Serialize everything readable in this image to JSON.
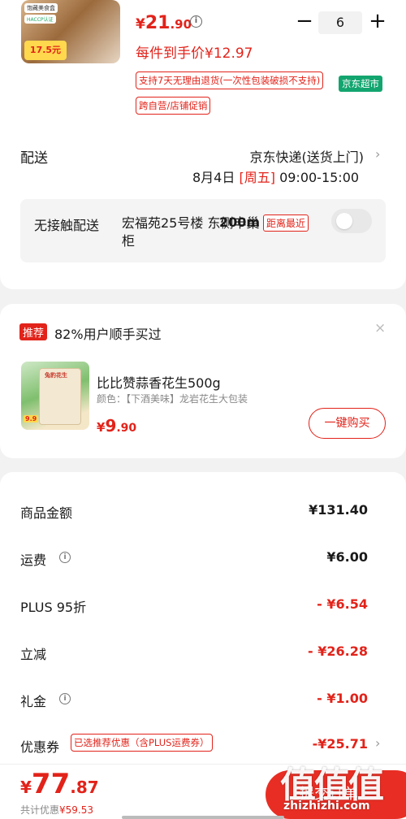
{
  "product": {
    "thumb_tags": [
      "饱藏美食盒",
      "HACCP认证",
      "17.5元"
    ],
    "price_currency": "¥",
    "price_int": "21",
    "price_dec": ".90",
    "quantity": "6",
    "minus_label": "−",
    "plus_label": "+",
    "hand_price": "每件到手价¥12.97",
    "return_policy": "支持7天无理由退货(一次性包装破损不支持)",
    "jd_market": "京东超市",
    "promo": "跨自营/店铺促销"
  },
  "delivery": {
    "label": "配送",
    "method": "京东快递(送货上门)",
    "date": "8月4日",
    "weekday": "[周五]",
    "time": "09:00-15:00",
    "contactless_label": "无接触配送",
    "address": "宏福苑25号楼 东侧丰巢柜",
    "distance": "200m",
    "nearest": "距离最近"
  },
  "recommend": {
    "tag": "推荐",
    "text": "82%用户顺手买过",
    "close": "×",
    "img_label": "兔豹花生",
    "img_price": "9.9",
    "title": "比比赞蒜香花生500g",
    "subtitle": "颜色：【下酒美味】龙岩花生大包装",
    "price_currency": "¥",
    "price_int": "9",
    "price_dec": ".90",
    "buy_label": "一键购买"
  },
  "summary": {
    "rows": [
      {
        "label": "商品金额",
        "value": "¥131.40"
      },
      {
        "label": "运费",
        "value": "¥6.00"
      },
      {
        "label": "PLUS 95折",
        "value": "- ¥6.54"
      },
      {
        "label": "立减",
        "value": "- ¥26.28"
      },
      {
        "label": "礼金",
        "value": "- ¥1.00"
      },
      {
        "label": "优惠券",
        "value": "-¥25.71"
      }
    ],
    "coupon_tag": "已选推荐优惠（含PLUS运费券）"
  },
  "bottom": {
    "total_currency": "¥",
    "total_int": "77",
    "total_dec": ".87",
    "saved_label": "共计优惠",
    "saved_amount": "¥59.53",
    "submit_label": "提交订单"
  },
  "watermark": {
    "big": "值值值",
    "site": "zhizhizhi.com"
  },
  "colors": {
    "accent_red": "#e2231a",
    "jd_green": "#13a56f",
    "page_bg": "#f2f2f2"
  }
}
